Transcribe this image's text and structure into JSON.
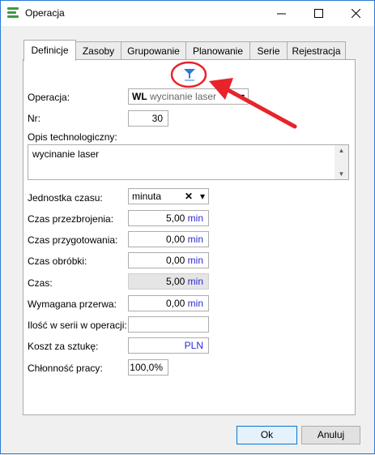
{
  "window": {
    "title": "Operacja"
  },
  "tabs": [
    "Definicje",
    "Zasoby",
    "Grupowanie",
    "Planowanie",
    "Serie",
    "Rejestracja"
  ],
  "form": {
    "operacja": {
      "label": "Operacja:",
      "code": "WL",
      "name": "wycinanie laser"
    },
    "nr": {
      "label": "Nr:",
      "value": "30"
    },
    "opis": {
      "label": "Opis technologiczny:",
      "value": "wycinanie laser"
    },
    "jednostka": {
      "label": "Jednostka czasu:",
      "value": "minuta"
    },
    "czas_przezbrojenia": {
      "label": "Czas przezbrojenia:",
      "value": "5,00",
      "unit": "min"
    },
    "czas_przygotowania": {
      "label": "Czas przygotowania:",
      "value": "0,00",
      "unit": "min"
    },
    "czas_obrobki": {
      "label": "Czas obróbki:",
      "value": "0,00",
      "unit": "min"
    },
    "czas": {
      "label": "Czas:",
      "value": "5,00",
      "unit": "min"
    },
    "przerwa": {
      "label": "Wymagana przerwa:",
      "value": "0,00",
      "unit": "min"
    },
    "ilosc": {
      "label": "Ilość w serii w operacji:",
      "value": ""
    },
    "koszt": {
      "label": "Koszt za sztukę:",
      "unit": "PLN"
    },
    "chlonnosc": {
      "label": "Chłonność pracy:",
      "value": "100,0%"
    }
  },
  "buttons": {
    "ok": "Ok",
    "cancel": "Anuluj"
  },
  "colors": {
    "accent": "#2b7bd4",
    "annotation": "#e8232b",
    "unit": "#2a2ad4"
  }
}
